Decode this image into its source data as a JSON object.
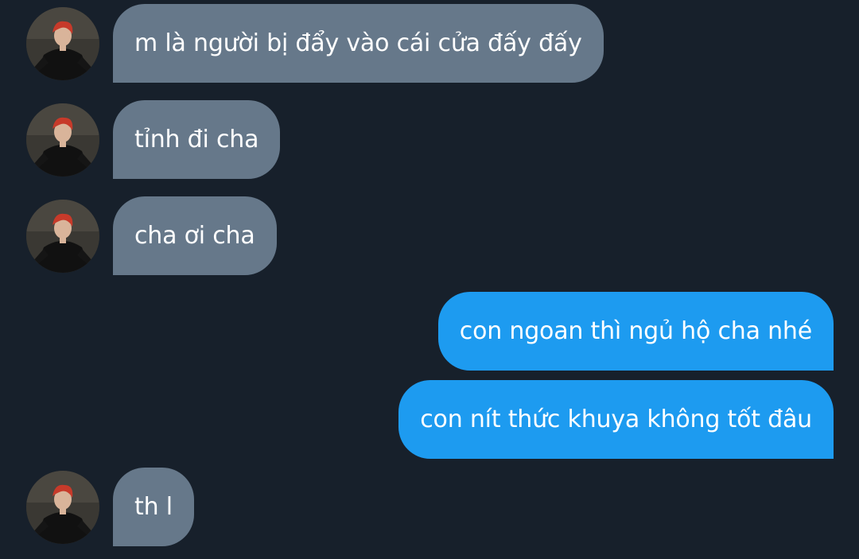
{
  "conversation": {
    "messages": [
      {
        "direction": "incoming",
        "text": "m là người bị đẩy vào cái cửa đấy đấy",
        "avatar": "user-avatar"
      },
      {
        "direction": "incoming",
        "text": "tỉnh đi cha",
        "avatar": "user-avatar"
      },
      {
        "direction": "incoming",
        "text": "cha ơi cha",
        "avatar": "user-avatar"
      },
      {
        "direction": "outgoing",
        "text": "con ngoan thì ngủ hộ cha nhé"
      },
      {
        "direction": "outgoing",
        "text": "con nít thức khuya không tốt đâu"
      },
      {
        "direction": "incoming",
        "text": "th l",
        "avatar": "user-avatar"
      }
    ]
  },
  "colors": {
    "background": "#17202b",
    "incoming_bubble": "#66788a",
    "outgoing_bubble": "#1d9bf0",
    "text": "#ffffff"
  }
}
